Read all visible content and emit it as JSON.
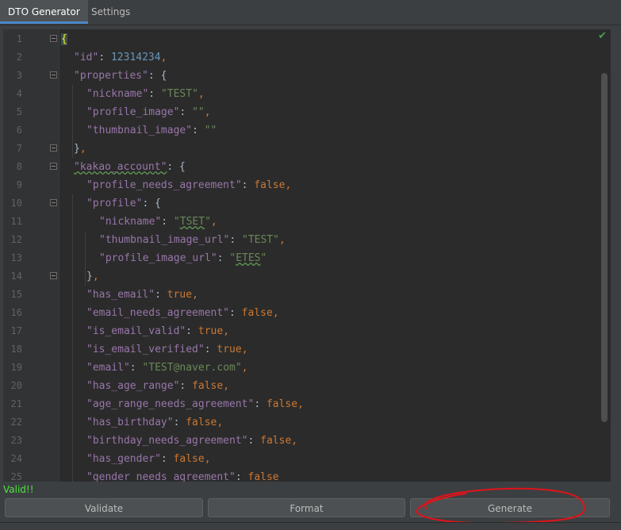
{
  "tabs": [
    {
      "label": "DTO Generator",
      "active": true
    },
    {
      "label": "Settings",
      "active": false
    }
  ],
  "editor": {
    "lines": [
      {
        "n": "1",
        "fold": true,
        "indent": 0,
        "tokens": [
          {
            "t": "{",
            "c": "brace-hl"
          }
        ]
      },
      {
        "n": "2",
        "fold": false,
        "indent": 1,
        "tokens": [
          {
            "t": "\"id\"",
            "c": "key"
          },
          {
            "t": ": ",
            "c": "brace"
          },
          {
            "t": "12314234",
            "c": "num"
          },
          {
            "t": ",",
            "c": "punc"
          }
        ]
      },
      {
        "n": "3",
        "fold": true,
        "indent": 1,
        "tokens": [
          {
            "t": "\"properties\"",
            "c": "key"
          },
          {
            "t": ": {",
            "c": "brace"
          }
        ]
      },
      {
        "n": "4",
        "fold": false,
        "indent": 2,
        "tokens": [
          {
            "t": "\"nickname\"",
            "c": "key"
          },
          {
            "t": ": ",
            "c": "brace"
          },
          {
            "t": "\"TEST\"",
            "c": "str"
          },
          {
            "t": ",",
            "c": "punc"
          }
        ]
      },
      {
        "n": "5",
        "fold": false,
        "indent": 2,
        "tokens": [
          {
            "t": "\"profile_image\"",
            "c": "key"
          },
          {
            "t": ": ",
            "c": "brace"
          },
          {
            "t": "\"\"",
            "c": "str"
          },
          {
            "t": ",",
            "c": "punc"
          }
        ]
      },
      {
        "n": "6",
        "fold": false,
        "indent": 2,
        "tokens": [
          {
            "t": "\"thumbnail_image\"",
            "c": "key"
          },
          {
            "t": ": ",
            "c": "brace"
          },
          {
            "t": "\"\"",
            "c": "str"
          }
        ]
      },
      {
        "n": "7",
        "fold": true,
        "indent": 1,
        "tokens": [
          {
            "t": "}",
            "c": "brace"
          },
          {
            "t": ",",
            "c": "punc"
          }
        ]
      },
      {
        "n": "8",
        "fold": true,
        "indent": 1,
        "tokens": [
          {
            "t": "\"kakao_account\"",
            "c": "key squig"
          },
          {
            "t": ": {",
            "c": "brace"
          }
        ]
      },
      {
        "n": "9",
        "fold": false,
        "indent": 2,
        "tokens": [
          {
            "t": "\"profile_needs_agreement\"",
            "c": "key"
          },
          {
            "t": ": ",
            "c": "brace"
          },
          {
            "t": "false",
            "c": "kw"
          },
          {
            "t": ",",
            "c": "punc"
          }
        ]
      },
      {
        "n": "10",
        "fold": true,
        "indent": 2,
        "tokens": [
          {
            "t": "\"profile\"",
            "c": "key"
          },
          {
            "t": ": {",
            "c": "brace"
          }
        ]
      },
      {
        "n": "11",
        "fold": false,
        "indent": 3,
        "tokens": [
          {
            "t": "\"nickname\"",
            "c": "key"
          },
          {
            "t": ": ",
            "c": "brace"
          },
          {
            "t": "\"",
            "c": "str"
          },
          {
            "t": "TSET",
            "c": "str squig"
          },
          {
            "t": "\"",
            "c": "str"
          },
          {
            "t": ",",
            "c": "punc"
          }
        ]
      },
      {
        "n": "12",
        "fold": false,
        "indent": 3,
        "tokens": [
          {
            "t": "\"thumbnail_image_url\"",
            "c": "key"
          },
          {
            "t": ": ",
            "c": "brace"
          },
          {
            "t": "\"TEST\"",
            "c": "str"
          },
          {
            "t": ",",
            "c": "punc"
          }
        ]
      },
      {
        "n": "13",
        "fold": false,
        "indent": 3,
        "tokens": [
          {
            "t": "\"profile_image_url\"",
            "c": "key"
          },
          {
            "t": ": ",
            "c": "brace"
          },
          {
            "t": "\"",
            "c": "str"
          },
          {
            "t": "ETES",
            "c": "str squig"
          },
          {
            "t": "\"",
            "c": "str"
          }
        ]
      },
      {
        "n": "14",
        "fold": true,
        "indent": 2,
        "tokens": [
          {
            "t": "}",
            "c": "brace"
          },
          {
            "t": ",",
            "c": "punc"
          }
        ]
      },
      {
        "n": "15",
        "fold": false,
        "indent": 2,
        "tokens": [
          {
            "t": "\"has_email\"",
            "c": "key"
          },
          {
            "t": ": ",
            "c": "brace"
          },
          {
            "t": "true",
            "c": "kw"
          },
          {
            "t": ",",
            "c": "punc"
          }
        ]
      },
      {
        "n": "16",
        "fold": false,
        "indent": 2,
        "tokens": [
          {
            "t": "\"email_needs_agreement\"",
            "c": "key"
          },
          {
            "t": ": ",
            "c": "brace"
          },
          {
            "t": "false",
            "c": "kw"
          },
          {
            "t": ",",
            "c": "punc"
          }
        ]
      },
      {
        "n": "17",
        "fold": false,
        "indent": 2,
        "tokens": [
          {
            "t": "\"is_email_valid\"",
            "c": "key"
          },
          {
            "t": ": ",
            "c": "brace"
          },
          {
            "t": "true",
            "c": "kw"
          },
          {
            "t": ",",
            "c": "punc"
          }
        ]
      },
      {
        "n": "18",
        "fold": false,
        "indent": 2,
        "tokens": [
          {
            "t": "\"is_email_verified\"",
            "c": "key"
          },
          {
            "t": ": ",
            "c": "brace"
          },
          {
            "t": "true",
            "c": "kw"
          },
          {
            "t": ",",
            "c": "punc"
          }
        ]
      },
      {
        "n": "19",
        "fold": false,
        "indent": 2,
        "tokens": [
          {
            "t": "\"email\"",
            "c": "key"
          },
          {
            "t": ": ",
            "c": "brace"
          },
          {
            "t": "\"TEST@naver.com\"",
            "c": "str"
          },
          {
            "t": ",",
            "c": "punc"
          }
        ]
      },
      {
        "n": "20",
        "fold": false,
        "indent": 2,
        "tokens": [
          {
            "t": "\"has_age_range\"",
            "c": "key"
          },
          {
            "t": ": ",
            "c": "brace"
          },
          {
            "t": "false",
            "c": "kw"
          },
          {
            "t": ",",
            "c": "punc"
          }
        ]
      },
      {
        "n": "21",
        "fold": false,
        "indent": 2,
        "tokens": [
          {
            "t": "\"age_range_needs_agreement\"",
            "c": "key"
          },
          {
            "t": ": ",
            "c": "brace"
          },
          {
            "t": "false",
            "c": "kw"
          },
          {
            "t": ",",
            "c": "punc"
          }
        ]
      },
      {
        "n": "22",
        "fold": false,
        "indent": 2,
        "tokens": [
          {
            "t": "\"has_birthday\"",
            "c": "key"
          },
          {
            "t": ": ",
            "c": "brace"
          },
          {
            "t": "false",
            "c": "kw"
          },
          {
            "t": ",",
            "c": "punc"
          }
        ]
      },
      {
        "n": "23",
        "fold": false,
        "indent": 2,
        "tokens": [
          {
            "t": "\"birthday_needs_agreement\"",
            "c": "key"
          },
          {
            "t": ": ",
            "c": "brace"
          },
          {
            "t": "false",
            "c": "kw"
          },
          {
            "t": ",",
            "c": "punc"
          }
        ]
      },
      {
        "n": "24",
        "fold": false,
        "indent": 2,
        "tokens": [
          {
            "t": "\"has_gender\"",
            "c": "key"
          },
          {
            "t": ": ",
            "c": "brace"
          },
          {
            "t": "false",
            "c": "kw"
          },
          {
            "t": ",",
            "c": "punc"
          }
        ]
      },
      {
        "n": "25",
        "fold": false,
        "indent": 2,
        "tokens": [
          {
            "t": "\"gender_needs_agreement\"",
            "c": "key"
          },
          {
            "t": ": ",
            "c": "brace"
          },
          {
            "t": "false",
            "c": "kw"
          }
        ]
      }
    ]
  },
  "status": {
    "text": "Valid!!",
    "color": "#4fe341"
  },
  "buttons": {
    "validate": "Validate",
    "format": "Format",
    "generate": "Generate"
  },
  "colors": {
    "key": "#9876aa",
    "string": "#6a8759",
    "number": "#6897bb",
    "keyword": "#cc7832",
    "annotation": "#e0131b"
  },
  "icons": {
    "inspection": "checkmark-icon"
  }
}
